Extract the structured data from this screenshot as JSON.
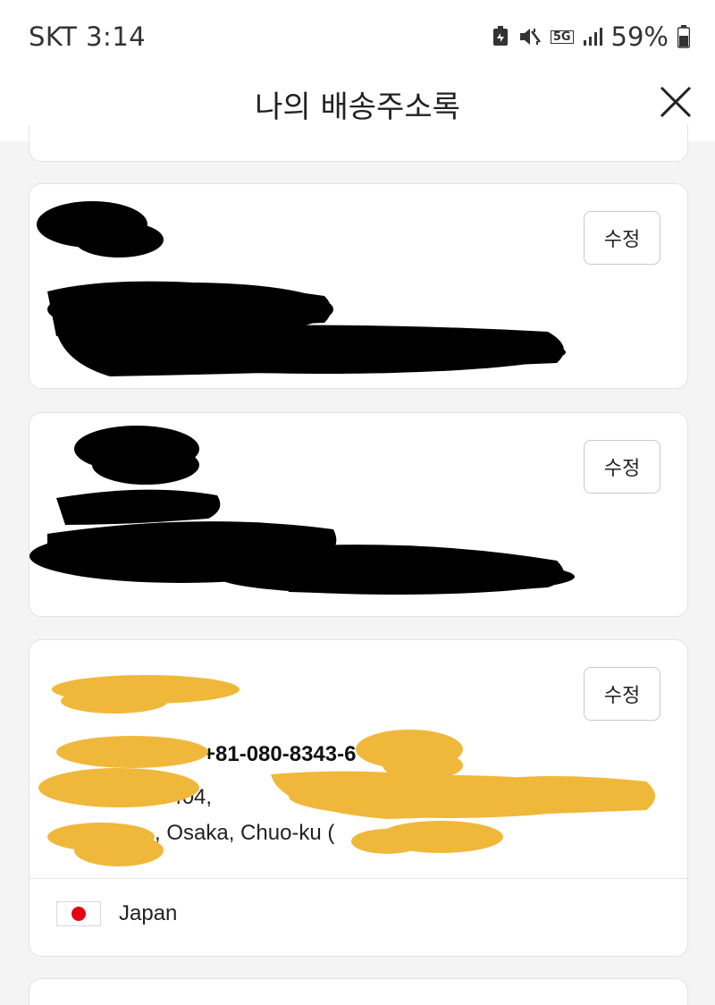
{
  "status_bar": {
    "carrier_time": "SKT 3:14",
    "network": "5G",
    "battery": "59%"
  },
  "header": {
    "title": "나의 배송주소록",
    "close_icon": "close-icon"
  },
  "addresses": [
    {
      "edit_label": "수정",
      "redacted": true,
      "redaction_color": "#000000"
    },
    {
      "edit_label": "수정",
      "redacted": true,
      "redaction_color": "#000000"
    },
    {
      "edit_label": "수정",
      "redaction_color": "#f0b83a",
      "phone_visible": "+81-080-8343-6",
      "line1_visible": "#404, ",
      "line2_visible": ", Osaka, Chuo-ku (",
      "country": "Japan",
      "country_flag": "japan-flag-icon"
    }
  ],
  "colors": {
    "background": "#f4f4f4",
    "card": "#ffffff",
    "border": "#e2e2e2",
    "black_redaction": "#000000",
    "yellow_redaction": "#f0b83a"
  }
}
